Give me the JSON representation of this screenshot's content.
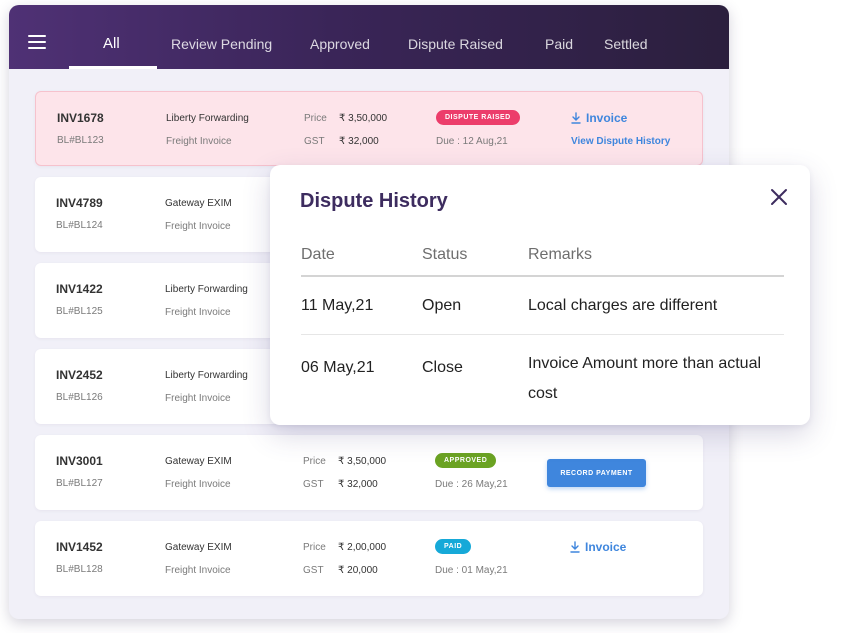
{
  "nav": {
    "menu_icon": "hamburger-menu-icon",
    "tabs": [
      {
        "label": "All",
        "active": true
      },
      {
        "label": "Review Pending",
        "active": false
      },
      {
        "label": "Approved",
        "active": false
      },
      {
        "label": "Dispute Raised",
        "active": false
      },
      {
        "label": "Paid",
        "active": false
      },
      {
        "label": "Settled",
        "active": false
      }
    ]
  },
  "labels": {
    "price": "Price",
    "gst": "GST"
  },
  "invoices": [
    {
      "id": "INV1678",
      "bl": "BL#BL123",
      "party": "Liberty Forwarding",
      "type": "Freight Invoice",
      "price": "₹ 3,50,000",
      "gst": "₹ 32,000",
      "status": "DISPUTE RAISED",
      "due": "Due : 12 Aug,21",
      "invoice_link": "Invoice",
      "history_link": "View Dispute History"
    },
    {
      "id": "INV4789",
      "bl": "BL#BL124",
      "party": "Gateway EXIM",
      "type": "Freight Invoice"
    },
    {
      "id": "INV1422",
      "bl": "BL#BL125",
      "party": "Liberty Forwarding",
      "type": "Freight Invoice"
    },
    {
      "id": "INV2452",
      "bl": "BL#BL126",
      "party": "Liberty Forwarding",
      "type": "Freight Invoice"
    },
    {
      "id": "INV3001",
      "bl": "BL#BL127",
      "party": "Gateway EXIM",
      "type": "Freight Invoice",
      "price": "₹ 3,50,000",
      "gst": "₹ 32,000",
      "status": "APPROVED",
      "due": "Due : 26 May,21",
      "action": "RECORD PAYMENT"
    },
    {
      "id": "INV1452",
      "bl": "BL#BL128",
      "party": "Gateway EXIM",
      "type": "Freight Invoice",
      "price": "₹ 2,00,000",
      "gst": "₹ 20,000",
      "status": "PAID",
      "due": "Due : 01 May,21",
      "invoice_link": "Invoice"
    }
  ],
  "dispute_history": {
    "title": "Dispute History",
    "columns": [
      "Date",
      "Status",
      "Remarks"
    ],
    "rows": [
      {
        "date": "11 May,21",
        "status": "Open",
        "remarks": "Local charges are different"
      },
      {
        "date": "06 May,21",
        "status": "Close",
        "remarks": "Invoice Amount more than actual cost"
      }
    ]
  },
  "colors": {
    "header_gradient_start": "#4f3175",
    "header_gradient_end": "#2b1f3d",
    "dispute_badge": "#ec3d6b",
    "approved_badge": "#6ba323",
    "paid_badge": "#16a9d8",
    "link_blue": "#3f86dd",
    "modal_title": "#3d2c5f",
    "highlight_row": "#fde4ea"
  }
}
